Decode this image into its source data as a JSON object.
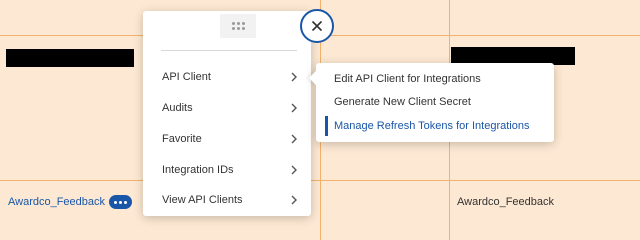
{
  "table": {
    "row_link_label": "Awardco_Feedback",
    "row_name_value": "Awardco_Feedback"
  },
  "context_menu": {
    "items": [
      {
        "label": "API Client"
      },
      {
        "label": "Audits"
      },
      {
        "label": "Favorite"
      },
      {
        "label": "Integration IDs"
      },
      {
        "label": "View API Clients"
      }
    ]
  },
  "submenu": {
    "items": [
      {
        "label": "Edit API Client for Integrations"
      },
      {
        "label": "Generate New Client Secret"
      },
      {
        "label": "Manage Refresh Tokens for Integrations",
        "active": true
      }
    ]
  },
  "icons": {
    "drag": "drag-handle-icon",
    "close": "close-icon",
    "more": "more-horizontal-icon",
    "chevron": "chevron-right-icon"
  },
  "colors": {
    "accent": "#1a56a8",
    "row_background": "#fde9d3",
    "grid_line": "#f2b26b"
  }
}
